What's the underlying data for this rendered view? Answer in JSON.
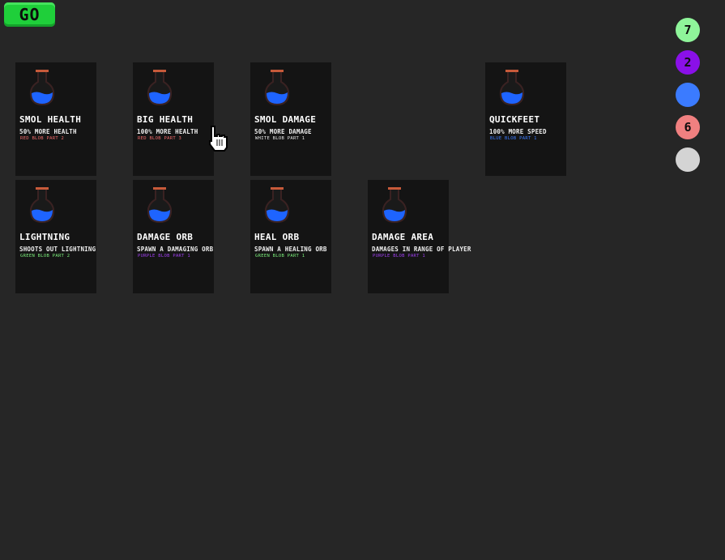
{
  "go_button": {
    "label": "GO",
    "color": "#1fcf3a"
  },
  "cards": [
    {
      "title": "SMOL HEALTH",
      "desc": "50% MORE HEALTH",
      "req": "RED BLOB PART 2",
      "req_color": "#f06a6a"
    },
    {
      "title": "BIG HEALTH",
      "desc": "100% MORE HEALTH",
      "req": "RED BLOB PART 3",
      "req_color": "#f06a6a"
    },
    {
      "title": "SMOL DAMAGE",
      "desc": "50% MORE DAMAGE",
      "req": "WHITE BLOB PART 1",
      "req_color": "#e8e8e8"
    },
    {
      "title": "QUICKFEET",
      "desc": "100% MORE SPEED",
      "req": "BLUE BLOB PART 1",
      "req_color": "#3b7bff"
    },
    {
      "title": "LIGHTNING",
      "desc": "SHOOTS OUT LIGHTNING",
      "req": "GREEN BLOB PART 2",
      "req_color": "#7cf07c"
    },
    {
      "title": "DAMAGE ORB",
      "desc": "SPAWN A DAMAGING ORB",
      "req": "PURPLE BLOB PART 1",
      "req_color": "#a040f0"
    },
    {
      "title": "HEAL ORB",
      "desc": "SPAWN A HEALING ORB",
      "req": "GREEN BLOB PART 1",
      "req_color": "#7cf07c"
    },
    {
      "title": "DAMAGE AREA",
      "desc": "DAMAGES IN RANGE OF PLAYER",
      "req": "PURPLE BLOB PART 1",
      "req_color": "#a040f0"
    }
  ],
  "blob_counters": [
    {
      "name": "green",
      "count": "7",
      "color": "#8ff59a"
    },
    {
      "name": "purple",
      "count": "2",
      "color": "#8a10e8"
    },
    {
      "name": "blue",
      "count": "",
      "color": "#3b7bff"
    },
    {
      "name": "red",
      "count": "6",
      "color": "#f08080"
    },
    {
      "name": "white",
      "count": "",
      "color": "#d4d4d4"
    }
  ],
  "icons": {
    "card_icon": "potion-icon",
    "pointer": "hand-cursor-icon"
  }
}
